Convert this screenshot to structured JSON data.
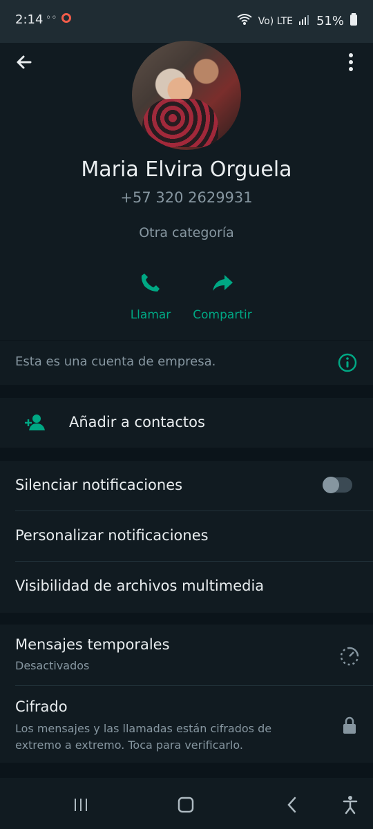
{
  "status_bar": {
    "time": "2:14",
    "left_icons": [
      "voicemail-icon",
      "recording-icon"
    ],
    "network_label": "Vo) LTE",
    "battery": "51%"
  },
  "contact": {
    "name": "Maria Elvira Orguela",
    "phone": "+57 320 2629931",
    "category": "Otra categoría",
    "avatar": "profile-photo"
  },
  "actions": [
    {
      "label": "Llamar",
      "icon": "phone-icon"
    },
    {
      "label": "Compartir",
      "icon": "share-icon"
    }
  ],
  "business_note": {
    "text": "Esta es una cuenta de empresa.",
    "icon": "info-icon"
  },
  "contacts": {
    "add_label": "Añadir a contactos",
    "icon": "add-contact-icon"
  },
  "notifications": [
    {
      "label": "Silenciar notificaciones",
      "control": "toggle",
      "state": "off"
    },
    {
      "label": "Personalizar notificaciones"
    },
    {
      "label": "Visibilidad de archivos multimedia"
    }
  ],
  "security": [
    {
      "label": "Mensajes temporales",
      "subtitle": "Desactivados",
      "icon": "timer-icon"
    },
    {
      "label": "Cifrado",
      "subtitle": "Los mensajes y las llamadas están cifrados de extremo a extremo. Toca para verificarlo.",
      "icon": "lock-icon"
    }
  ],
  "navigation": {
    "items": [
      "recents-icon",
      "home-icon",
      "back-icon",
      "accessibility-icon"
    ]
  },
  "colors": {
    "background": "#0b141a",
    "surface": "#111b21",
    "accent": "#00a884",
    "text_primary": "#e9edef",
    "text_secondary": "#8696a0"
  }
}
